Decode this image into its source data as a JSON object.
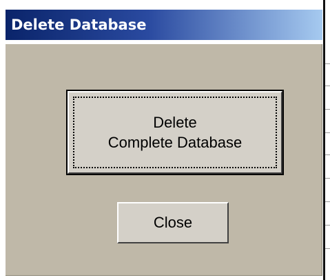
{
  "window": {
    "title": "Delete Database"
  },
  "buttons": {
    "delete_line1": "Delete",
    "delete_line2": "Complete Database",
    "close_label": "Close"
  },
  "colors": {
    "dialog_bg": "#bfb8a8",
    "titlebar_start": "#0a246a",
    "titlebar_end": "#a6caf0",
    "button_face": "#d4d0c8"
  }
}
